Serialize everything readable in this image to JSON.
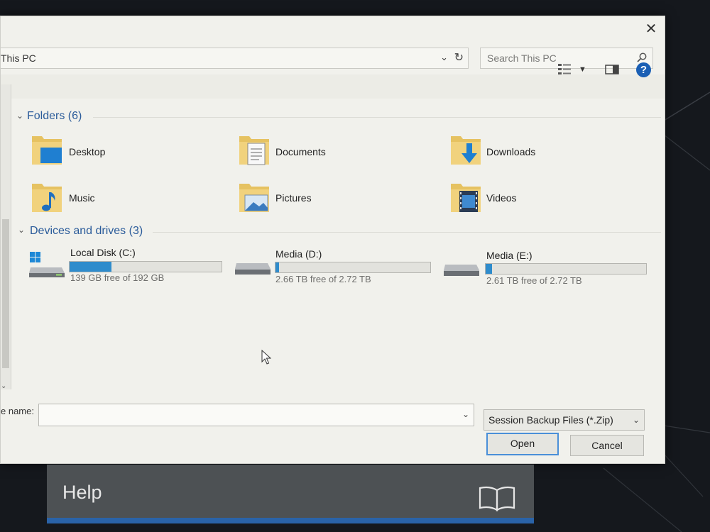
{
  "dialog": {
    "close_glyph": "✕",
    "address": "This PC",
    "search_placeholder": "Search This PC"
  },
  "groups": {
    "folders_header": "Folders (6)",
    "drives_header": "Devices and drives (3)"
  },
  "folders": [
    {
      "label": "Desktop",
      "icon": "desktop-folder-icon"
    },
    {
      "label": "Documents",
      "icon": "documents-folder-icon"
    },
    {
      "label": "Downloads",
      "icon": "downloads-folder-icon"
    },
    {
      "label": "Music",
      "icon": "music-folder-icon"
    },
    {
      "label": "Pictures",
      "icon": "pictures-folder-icon"
    },
    {
      "label": "Videos",
      "icon": "videos-folder-icon"
    }
  ],
  "drives": [
    {
      "label": "Local Disk (C:)",
      "free": "139 GB free of 192 GB",
      "used_fraction": 0.276,
      "icon": "windows-drive-icon"
    },
    {
      "label": "Media (D:)",
      "free": "2.66 TB free of 2.72 TB",
      "used_fraction": 0.022,
      "icon": "hard-drive-icon"
    },
    {
      "label": "Media (E:)",
      "free": "2.61 TB free of 2.72 TB",
      "used_fraction": 0.04,
      "icon": "hard-drive-icon"
    }
  ],
  "footer": {
    "file_name_label": "e name:",
    "file_name_value": "",
    "filter": "Session Backup Files (*.Zip)",
    "open_label": "Open",
    "cancel_label": "Cancel"
  },
  "helpbar": {
    "label": "Help"
  },
  "colors": {
    "accent": "#2f8ccc",
    "group_header": "#2a5b9a",
    "help_blue": "#1a5fb4"
  }
}
